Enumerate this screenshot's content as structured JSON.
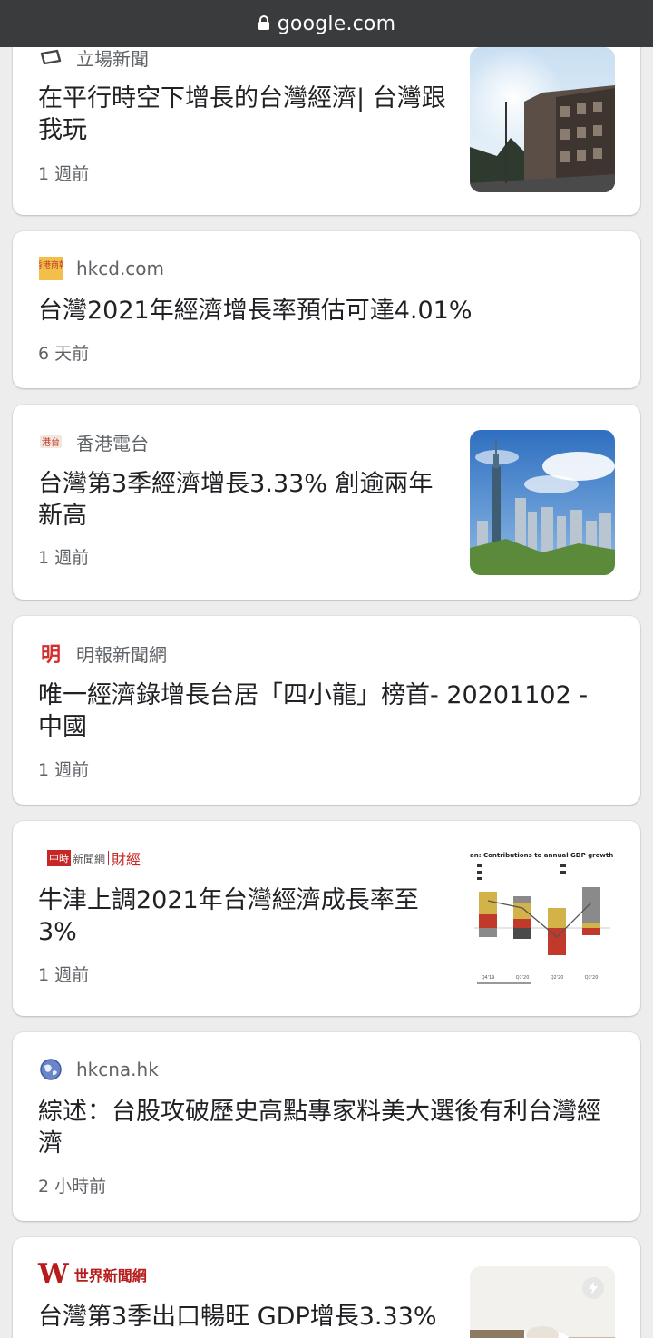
{
  "browser": {
    "domain": "google.com"
  },
  "cards": [
    {
      "source": "立場新聞",
      "headline": "在平行時空下增長的台灣經濟| 台灣跟我玩",
      "age": "1 週前"
    },
    {
      "source": "hkcd.com",
      "headline": "台灣2021年經濟增長率預估可達4.01%",
      "age": "6 天前"
    },
    {
      "source": "香港電台",
      "headline": "台灣第3季經濟增長3.33% 創逾兩年新高",
      "age": "1 週前"
    },
    {
      "source": "明報新聞網",
      "headline": "唯一經濟錄增長台居「四小龍」榜首- 20201102 - 中國",
      "age": "1 週前"
    },
    {
      "source": "中時新聞網|財經",
      "headline": "牛津上調2021年台灣經濟成長率至3%",
      "age": "1 週前"
    },
    {
      "source": "hkcna.hk",
      "headline": "綜述：台股攻破歷史高點專家料美大選後有利台灣經濟",
      "age": "2 小時前"
    },
    {
      "source": "世界新聞網",
      "headline": "台灣第3季出口暢旺 GDP增長3.33%",
      "age": ""
    }
  ],
  "logos": {
    "hkcd": "香港商報",
    "rthk": "港台",
    "mingpao": "明",
    "chinatimes_brand": "中時",
    "chinatimes_site": "新聞網",
    "chinatimes_section": "財經",
    "udn_mark": "W",
    "udn_name": "世界新聞網"
  },
  "thumbnail_chart": {
    "title": "an: Contributions to annual GDP growth",
    "xticks": [
      "Q4'19",
      "Q1'20",
      "Q2'20",
      "Q3'20"
    ]
  },
  "colors": {
    "urlbar": "#3a3b3d",
    "card": "#ffffff",
    "background": "#ededed",
    "meta_text": "#5f6368",
    "headline_text": "#202124"
  }
}
